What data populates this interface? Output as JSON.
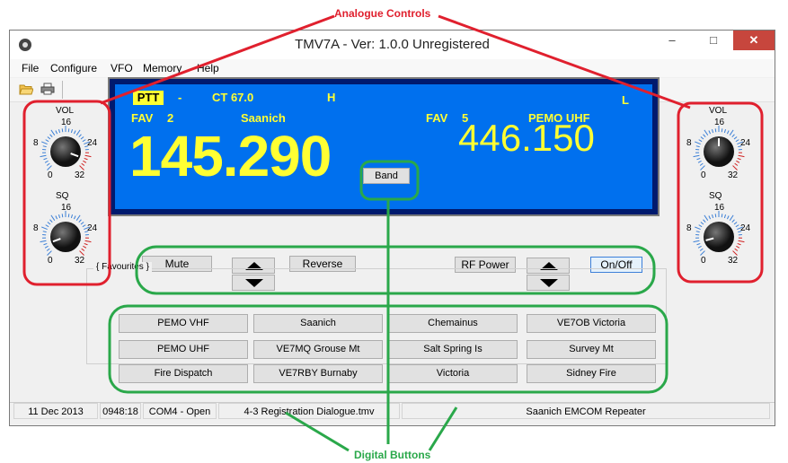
{
  "annotations": {
    "analogue": "Analogue Controls",
    "digital": "Digital Buttons",
    "red": "#e0202e",
    "green": "#2aa84a"
  },
  "window": {
    "title": "TMV7A - Ver: 1.0.0  Unregistered",
    "min": "–",
    "max": "□",
    "close": "✕"
  },
  "menu": [
    "File",
    "Configure",
    "VFO",
    "Memory",
    "Help"
  ],
  "toolbar": {
    "icons": [
      "open-folder-icon",
      "print-icon"
    ]
  },
  "knobs": {
    "left": [
      {
        "label": "VOL",
        "top": "16",
        "left": "8",
        "right": "24",
        "bl": "0",
        "br": "32"
      },
      {
        "label": "SQ",
        "top": "16",
        "left": "8",
        "right": "24",
        "bl": "0",
        "br": "32"
      }
    ],
    "right": [
      {
        "label": "VOL",
        "top": "16",
        "left": "8",
        "right": "24",
        "bl": "0",
        "br": "32"
      },
      {
        "label": "SQ",
        "top": "16",
        "left": "8",
        "right": "24",
        "bl": "0",
        "br": "32"
      }
    ]
  },
  "display": {
    "ptt": "PTT",
    "dash": "-",
    "ct": "CT  67.0",
    "h": "H",
    "l": "L",
    "fav_a_label": "FAV",
    "fav_a_num": "2",
    "fav_a_name": "Saanich",
    "freq_a": "145.290",
    "fav_b_label": "FAV",
    "fav_b_num": "5",
    "fav_b_name": "PEMO UHF",
    "freq_b": "446.150",
    "band": "Band",
    "colors": {
      "bg": "#0070ee",
      "text": "#ffff33"
    }
  },
  "controls": {
    "mute": "Mute",
    "reverse": "Reverse",
    "rf_power": "RF Power",
    "on_off": "On/Off"
  },
  "favourites": {
    "legend": "{ Favourites }",
    "buttons": [
      [
        "PEMO VHF",
        "Saanich",
        "Chemainus",
        "VE7OB Victoria"
      ],
      [
        "PEMO UHF",
        "VE7MQ Grouse Mt",
        "Salt Spring Is",
        "Survey Mt"
      ],
      [
        "Fire Dispatch",
        "VE7RBY Burnaby",
        "Victoria",
        "Sidney Fire"
      ]
    ]
  },
  "status": [
    "11 Dec 2013",
    "0948:18",
    "COM4 - Open",
    "4-3 Registration Dialogue.tmv",
    "Saanich EMCOM Repeater"
  ]
}
